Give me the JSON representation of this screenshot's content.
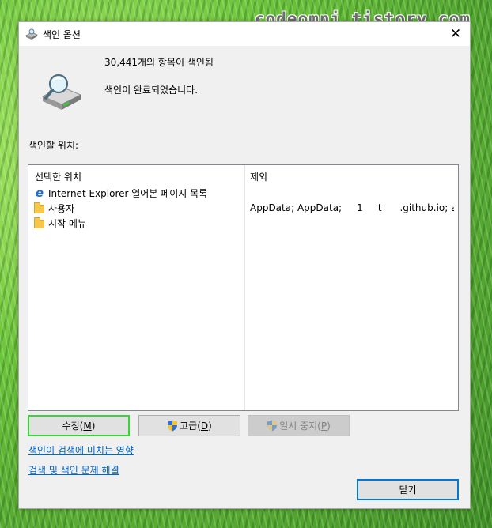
{
  "watermark": "codeomni.tistory.com",
  "window": {
    "title": "색인 옵션",
    "close_glyph": "✕"
  },
  "summary": {
    "indexed_count": "30,441개의 항목이 색인됨",
    "status": "색인이 완료되었습니다."
  },
  "locations": {
    "label": "색인할 위치:",
    "col_selected": "선택한 위치",
    "col_exclude": "제외",
    "items": [
      {
        "name": "Internet Explorer 열어본 페이지 목록",
        "icon": "ie-icon",
        "exclude": ""
      },
      {
        "name": "사용자",
        "icon": "folder-icon",
        "exclude": "AppData; AppData;     1     t      .github.io; a..."
      },
      {
        "name": "시작 메뉴",
        "icon": "folder-icon",
        "exclude": ""
      }
    ]
  },
  "buttons": {
    "modify": {
      "label": "수정(",
      "key": "M",
      "tail": ")"
    },
    "advanced": {
      "label": "고급(",
      "key": "D",
      "tail": ")"
    },
    "pause": {
      "label": "일시 중지(",
      "key": "P",
      "tail": ")"
    },
    "close": "닫기"
  },
  "links": {
    "affect": "색인이 검색에 미치는 영향",
    "troubleshoot": "검색 및 색인 문제 해결"
  },
  "colors": {
    "link": "#0066cc",
    "focus_green": "#36d636",
    "focus_blue": "#0078d7"
  }
}
